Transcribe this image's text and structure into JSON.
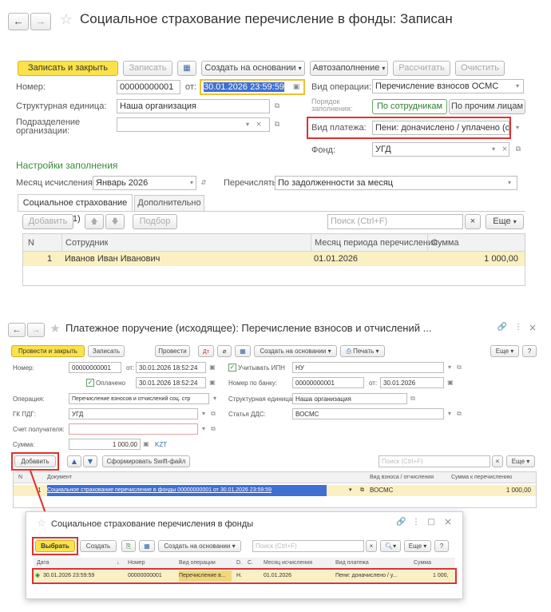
{
  "top": {
    "title": "Социальное страхование перечисление в фонды: Записан",
    "toolbar": {
      "save_close": "Записать и закрыть",
      "save": "Записать",
      "create_based": "Создать на основании",
      "autofill": "Автозаполнение",
      "calculate": "Рассчитать",
      "clear": "Очистить"
    },
    "number_label": "Номер:",
    "number": "00000000001",
    "from_label": "от:",
    "date": "30.01.2026 23:59:59",
    "operation_label": "Вид операции:",
    "operation": "Перечисление взносов ОСМС",
    "unit_label": "Структурная единица:",
    "unit": "Наша организация",
    "order_label": "Порядок заполнения:",
    "by_employees": "По сотрудникам",
    "by_others": "По прочим лицам",
    "subdivision_label": "Подразделение организации:",
    "payment_type_label": "Вид платежа:",
    "payment_type": "Пени: доначислено / уплачено (сам",
    "fund_label": "Фонд:",
    "fund": "УГД",
    "settings_title": "Настройки заполнения",
    "month_label": "Месяц исчисления:",
    "month": "Январь 2026",
    "transfer_label": "Перечислять:",
    "transfer": "По задолженности за месяц",
    "tabs": [
      "Социальное страхование (1)",
      "Дополнительно"
    ],
    "add": "Добавить",
    "pick": "Подбор",
    "search_placeholder": "Поиск (Ctrl+F)",
    "more": "Еще",
    "columns": [
      "N",
      "Сотрудник",
      "Месяц периода перечисления",
      "Сумма"
    ],
    "rows": [
      {
        "n": "1",
        "employee": "Иванов Иван Иванович",
        "month": "01.01.2026",
        "sum": "1 000,00"
      }
    ]
  },
  "bottom": {
    "title": "Платежное поручение (исходящее): Перечисление взносов и отчислений ...",
    "toolbar": {
      "post_close": "Провести и закрыть",
      "save": "Записать",
      "post": "Провести",
      "create_based": "Создать на основании",
      "print": "Печать",
      "more": "Еще",
      "help": "?"
    },
    "number_label": "Номер:",
    "number": "00000000001",
    "from_label": "от:",
    "date": "30.01.2026 18:52:24",
    "ipn_label": "Учитывать ИПН",
    "ipn": "НУ",
    "paid_label": "Оплачено",
    "paid_date": "30.01.2026 18:52:24",
    "bank_number_label": "Номер по банку:",
    "bank_number": "00000000001",
    "bank_from_label": "от:",
    "bank_date": "30.01.2026",
    "operation_label": "Операция:",
    "operation": "Перечисление взносов и отчислений соц. стр",
    "unit_label": "Структурная единица:",
    "unit": "Наша организация",
    "gk_label": "ГК ПДГ:",
    "gk": "УГД",
    "dds_label": "Статья ДДС:",
    "dds": "ВОСМС",
    "account_label": "Счет получателя:",
    "sum_label": "Сумма:",
    "sum": "1 000,00",
    "currency": "KZT",
    "add": "Добавить",
    "swift": "Сформировать Swift-файл",
    "search_placeholder": "Поиск (Ctrl+F)",
    "more2": "Еще",
    "columns": [
      "N",
      "Документ",
      "Вид взноса / отчисления",
      "Сумма к перечислению"
    ],
    "rows": [
      {
        "n": "1",
        "doc": "Социальное страхование перечисление в фонды 00000000001 от 30.01.2026 23:59:59",
        "kind": "ВОСМС",
        "sum": "1 000,00"
      }
    ]
  },
  "popup": {
    "title": "Социальное страхование перечисления в фонды",
    "select": "Выбрать",
    "create": "Создать",
    "create_based": "Создать на основании",
    "search_placeholder": "Поиск (Ctrl+F)",
    "more": "Еще",
    "help": "?",
    "columns": [
      "Дата",
      "Номер",
      "Вид операции",
      "D.",
      "C.",
      "Месяц исчисления",
      "Вид платежа",
      "Сумма"
    ],
    "rows": [
      {
        "date": "30.01.2026 23:59:59",
        "number": "00000000001",
        "op": "Перечисление в...",
        "d": "Н.",
        "c": "",
        "month": "01.01.2026",
        "pay": "Пени: доначислено / у...",
        "sum": "1 000,"
      }
    ]
  },
  "colors": {
    "accent_yellow": "#fbe24a",
    "highlight_red": "#e03030",
    "selection_blue": "#3f6fd1",
    "row_yellow": "#fbf0c2",
    "section_green": "#3a8a3a"
  }
}
